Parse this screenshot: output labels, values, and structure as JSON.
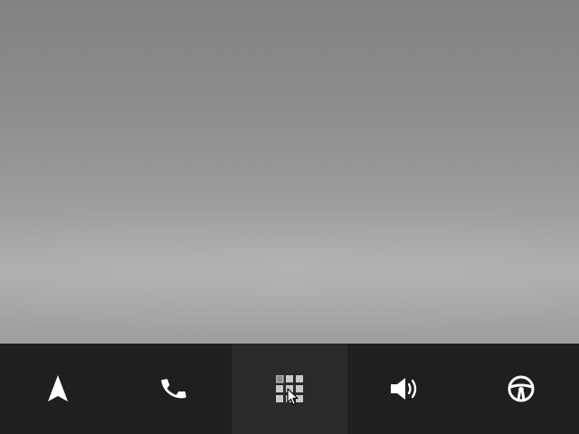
{
  "dock": {
    "items": [
      {
        "name": "navigation",
        "icon": "navigation-arrow-icon",
        "active": false
      },
      {
        "name": "phone",
        "icon": "phone-icon",
        "active": false
      },
      {
        "name": "apps",
        "icon": "app-grid-icon",
        "active": true
      },
      {
        "name": "audio",
        "icon": "volume-icon",
        "active": false
      },
      {
        "name": "vehicle",
        "icon": "steering-wheel-icon",
        "active": false
      }
    ]
  },
  "colors": {
    "dock_background": "#1f1f1f",
    "dock_active_background": "#2a2a2a",
    "icon": "#ffffff",
    "grid_tile": "#c8c8c8",
    "wallpaper_top": "#828282",
    "wallpaper_band": "#ababab"
  },
  "cursor": {
    "icon": "mouse-pointer-icon"
  }
}
